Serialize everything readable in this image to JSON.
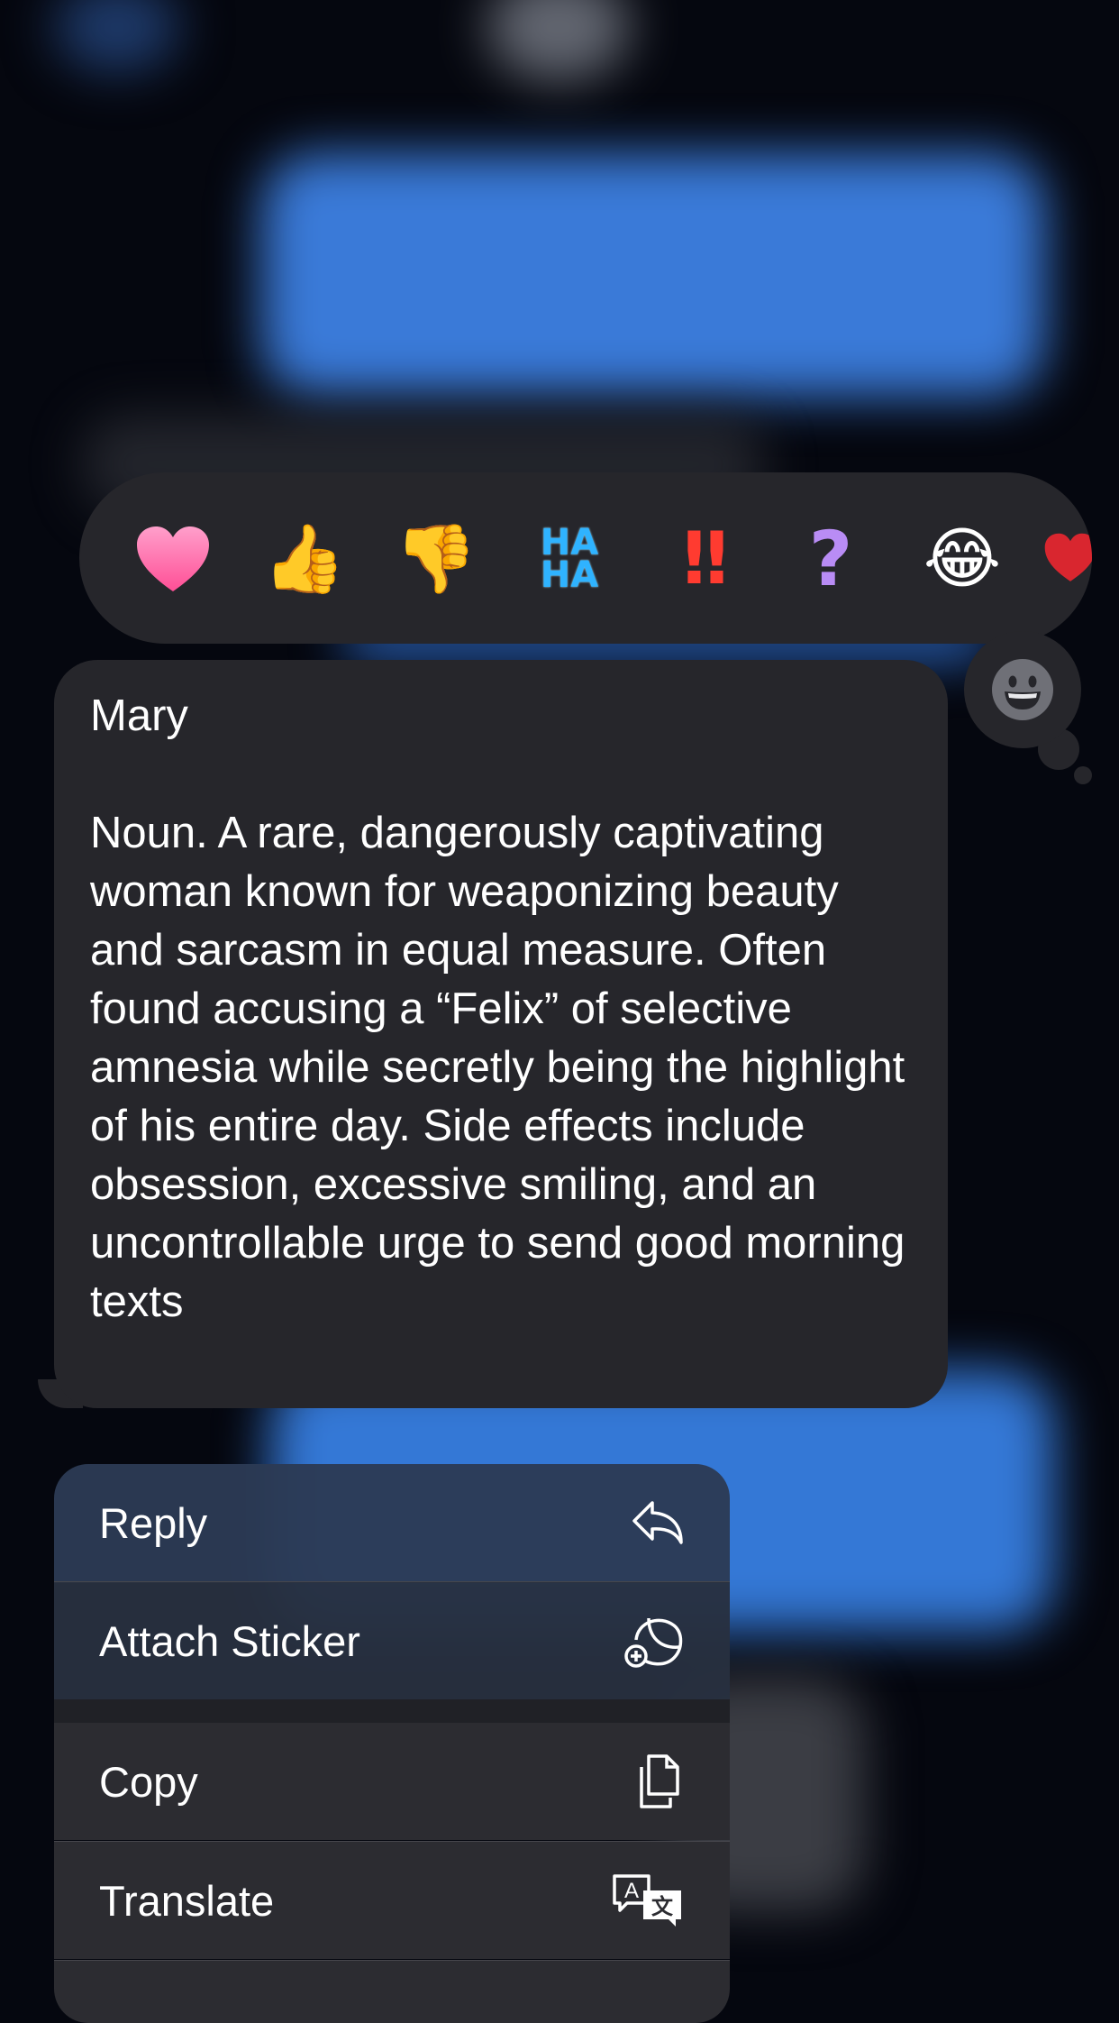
{
  "reactions": [
    {
      "name": "heart",
      "glyph": "❤"
    },
    {
      "name": "thumbs-up",
      "glyph": "👍"
    },
    {
      "name": "thumbs-down",
      "glyph": "👎"
    },
    {
      "name": "haha",
      "glyph": "HA\nHA"
    },
    {
      "name": "exclamation",
      "glyph": "‼"
    },
    {
      "name": "question",
      "glyph": "?"
    },
    {
      "name": "laughing",
      "glyph": "😂"
    }
  ],
  "message": {
    "text": "Mary\n\nNoun. A rare, dangerously captivating woman known for weaponizing beauty and sarcasm in equal measure. Often found accusing a “Felix” of selective amnesia while secretly being the highlight of his entire day. Side effects include obsession, excessive smiling, and an uncontrollable urge to send good morning texts"
  },
  "menu": {
    "reply": "Reply",
    "attach_sticker": "Attach Sticker",
    "copy": "Copy",
    "translate": "Translate"
  },
  "colors": {
    "bubble": "#26262b",
    "accent_blue": "#3478d6",
    "heart": "#ff5fa2"
  }
}
